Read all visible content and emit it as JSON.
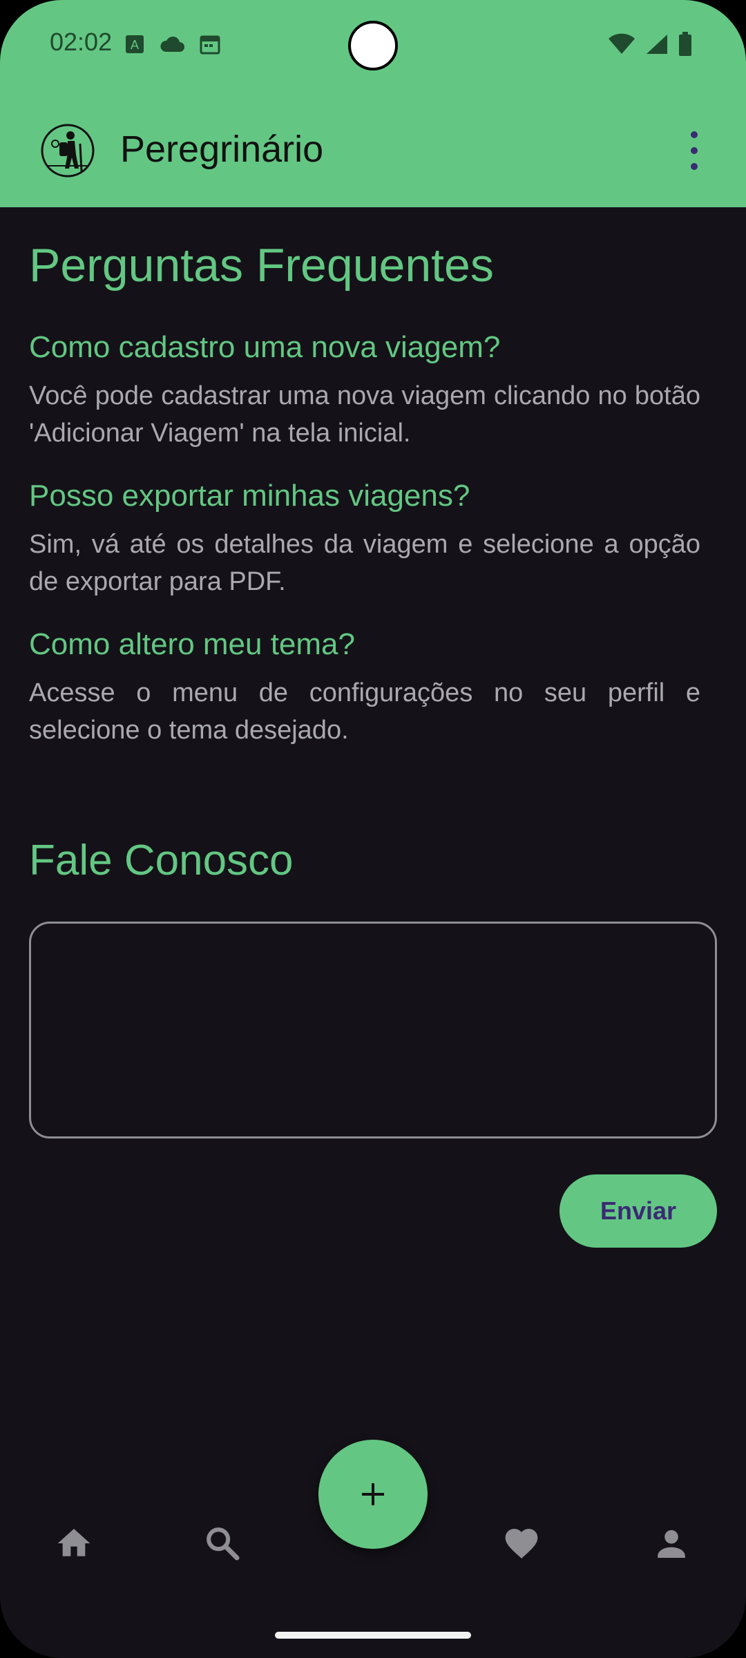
{
  "status_bar": {
    "time": "02:02"
  },
  "app_bar": {
    "title": "Peregrinário"
  },
  "faq": {
    "title": "Perguntas Frequentes",
    "items": [
      {
        "question": "Como cadastro uma nova viagem?",
        "answer": "Você pode cadastrar uma nova viagem clicando no botão 'Adicionar Viagem' na tela inicial."
      },
      {
        "question": "Posso exportar minhas viagens?",
        "answer": "Sim, vá até os detalhes da viagem e selecione a opção de exportar para PDF."
      },
      {
        "question": "Como altero meu tema?",
        "answer": "Acesse o menu de configurações no seu perfil e selecione o tema desejado."
      }
    ]
  },
  "contact": {
    "title": "Fale Conosco",
    "message_value": "",
    "send_label": "Enviar"
  },
  "bottom_nav": {
    "items": [
      "home-icon",
      "search-icon",
      "add-icon",
      "heart-icon",
      "profile-icon"
    ]
  },
  "colors": {
    "accent": "#63C783",
    "background": "#141218",
    "body_text": "#A9A9AE",
    "button_text": "#3B2A74"
  }
}
